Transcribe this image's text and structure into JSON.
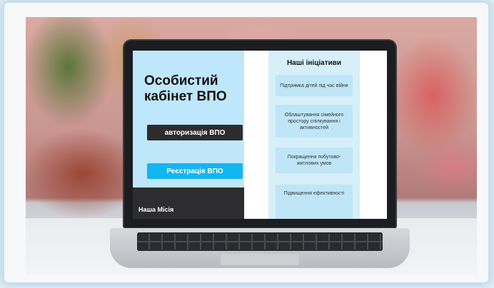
{
  "site": {
    "cabinet_title": "Особистий кабінет ВПО",
    "auth_button": "авторизація ВПО",
    "register_button": "Реєстрація ВПО",
    "mission_label": "Наша Місія"
  },
  "initiatives": {
    "title": "Наші ініціативи",
    "items": [
      "Підтримка дітей під час війни",
      "Облаштування сімейного простору спілкування і активностей",
      "Покращення побутово-житлових умов",
      "Підвищення ефективності"
    ]
  },
  "colors": {
    "left_panel": "#bfe7fb",
    "auth_button": "#2c2c2e",
    "register_button": "#14b6ef",
    "right_panel": "#d6eff9",
    "card": "#bfe6f7"
  }
}
